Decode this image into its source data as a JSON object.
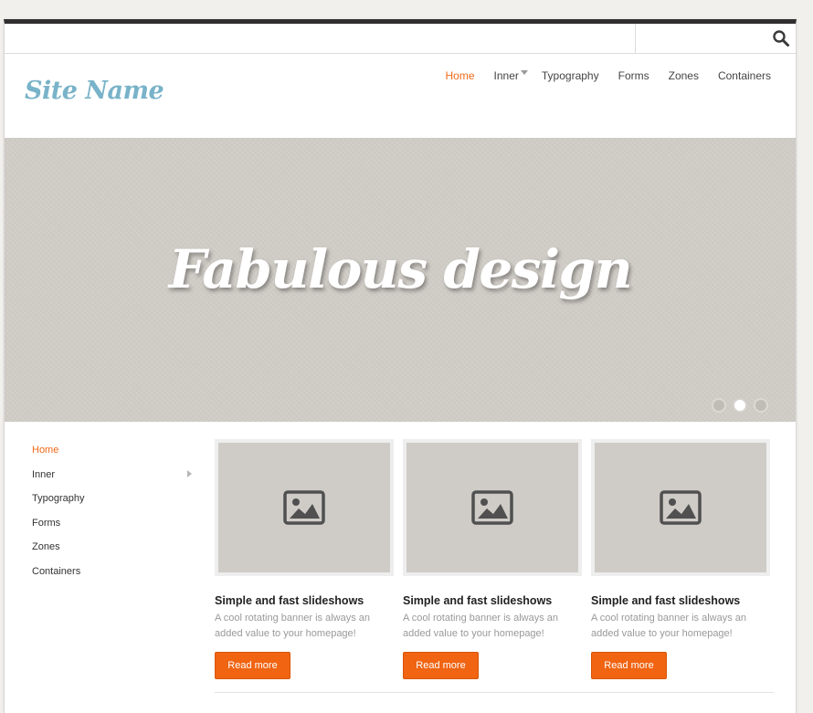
{
  "search": {
    "placeholder": ""
  },
  "site_name": "Site Name",
  "nav": [
    {
      "label": "Home",
      "active": true
    },
    {
      "label": "Inner",
      "has_submenu": true
    },
    {
      "label": "Typography"
    },
    {
      "label": "Forms"
    },
    {
      "label": "Zones"
    },
    {
      "label": "Containers"
    }
  ],
  "banner": {
    "heading": "Fabulous design",
    "slides": 3,
    "active_slide": 2
  },
  "sidebar": {
    "items": [
      {
        "label": "Home",
        "active": true
      },
      {
        "label": "Inner",
        "has_submenu": true
      },
      {
        "label": "Typography"
      },
      {
        "label": "Forms"
      },
      {
        "label": "Zones"
      },
      {
        "label": "Containers"
      }
    ]
  },
  "cards": [
    {
      "title": "Simple and fast slideshows",
      "desc": "A cool rotating banner is always an added value to your homepage!",
      "button": "Read more",
      "icon": "image-icon"
    },
    {
      "title": "Simple and fast slideshows",
      "desc": "A cool rotating banner is always an added value to your homepage!",
      "button": "Read more",
      "icon": "image-icon"
    },
    {
      "title": "Simple and fast slideshows",
      "desc": "A cool rotating banner is always an added value to your homepage!",
      "button": "Read more",
      "icon": "image-icon"
    }
  ],
  "colors": {
    "accent": "#ef6a1a",
    "site_name": "#79b3c9",
    "banner_bg": "#cdc9c3",
    "button": "#f06412"
  }
}
